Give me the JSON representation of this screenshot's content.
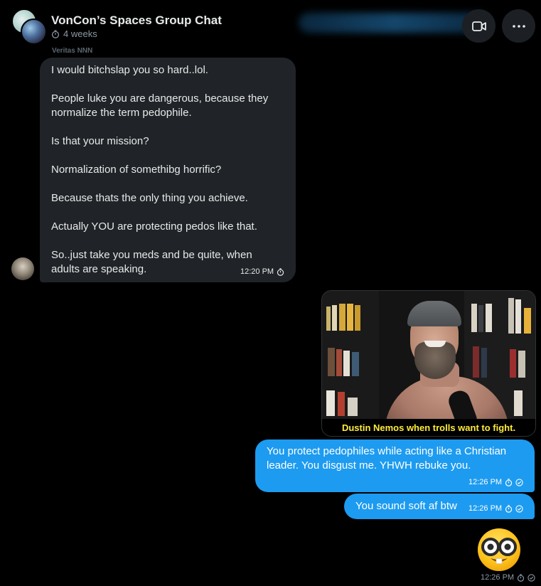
{
  "header": {
    "title": "VonCon’s Spaces Group Chat",
    "subtitle": "4 weeks",
    "icons": {
      "timer": "timer-icon",
      "video": "video-call-icon",
      "more": "more-options-icon"
    }
  },
  "messages": {
    "incoming": {
      "sender": "Veritas NNN",
      "lines": [
        "I would bitchslap you so hard..lol.",
        "People luke you are dangerous, because they",
        "normalize the term pedophile.",
        "Is that your mission?",
        "Normalization of somethibg horrific?",
        "Because thats the only thing you achieve.",
        "Actually YOU are protecting pedos like that.",
        "So..just take you meds and be quite, when",
        "adults are speaking."
      ],
      "time": "12:20 PM"
    },
    "media": {
      "caption": "Dustin Nemos when trolls want to fight."
    },
    "outgoing": [
      {
        "lines": [
          "You protect pedophiles while acting like a Christian",
          "leader. You disgust me. YHWH rebuke you."
        ],
        "time": "12:26 PM"
      },
      {
        "lines": [
          "You sound soft af btw"
        ],
        "time": "12:26 PM"
      }
    ],
    "emoji_message": {
      "emoji": "nerd-face-emoji",
      "time": "12:26 PM"
    }
  },
  "colors": {
    "background": "#000000",
    "incoming_bubble": "#202327",
    "outgoing_bubble": "#1d9bf0",
    "caption": "#ffeb3b",
    "muted": "#8b98a5"
  }
}
